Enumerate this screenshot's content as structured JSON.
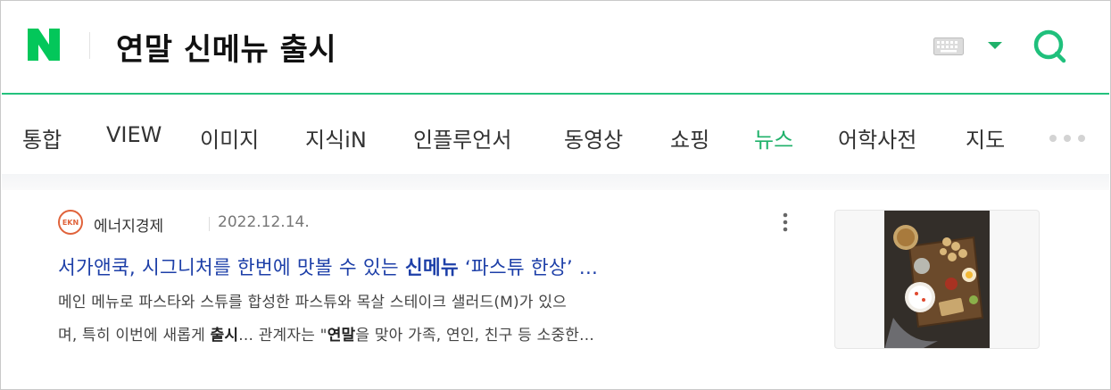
{
  "header": {
    "logo_icon": "naver-n-logo",
    "query": "연말 신메뉴 출시",
    "keyboard_icon": "keyboard-icon",
    "dropdown_icon": "caret-down-icon",
    "search_icon": "search-icon",
    "accent_color": "#1fb16a"
  },
  "tabs": [
    {
      "label": "통합"
    },
    {
      "label": "VIEW"
    },
    {
      "label": "이미지"
    },
    {
      "label": "지식iN"
    },
    {
      "label": "인플루언서"
    },
    {
      "label": "동영상"
    },
    {
      "label": "쇼핑"
    },
    {
      "label": "뉴스",
      "active": true
    },
    {
      "label": "어학사전"
    },
    {
      "label": "지도"
    }
  ],
  "more_icon": "more-dots-icon",
  "result": {
    "source_logo_text": "EKN",
    "source": "에너지경제",
    "date": "2022.12.14.",
    "title_pre": "서가앤쿡, 시그니처를 한번에 맛볼 수 있는 ",
    "title_bold": "신메뉴",
    "title_post": " ‘파스튜 한상’ ...",
    "desc_line1": "메인 메뉴로 파스타와 스튜를 합성한 파스튜와 목살 스테이크 샐러드(M)가 있으",
    "desc_line2_a": "며, 특히 이번에 새롭게 ",
    "desc_line2_b": "출시",
    "desc_line2_c": "... 관계자는 \"",
    "desc_line2_d": "연말",
    "desc_line2_e": "을 맞아 가족, 연인, 친구 등 소중한...",
    "thumbnail_icon": "food-platter-thumbnail"
  }
}
